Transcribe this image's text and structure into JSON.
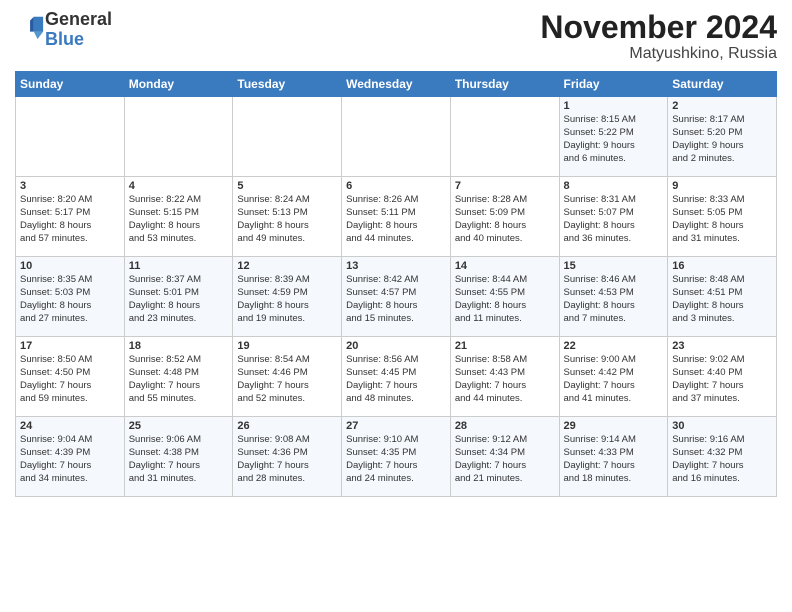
{
  "header": {
    "logo_general": "General",
    "logo_blue": "Blue",
    "month_title": "November 2024",
    "location": "Matyushkino, Russia"
  },
  "days_of_week": [
    "Sunday",
    "Monday",
    "Tuesday",
    "Wednesday",
    "Thursday",
    "Friday",
    "Saturday"
  ],
  "weeks": [
    [
      {
        "day": "",
        "info": ""
      },
      {
        "day": "",
        "info": ""
      },
      {
        "day": "",
        "info": ""
      },
      {
        "day": "",
        "info": ""
      },
      {
        "day": "",
        "info": ""
      },
      {
        "day": "1",
        "info": "Sunrise: 8:15 AM\nSunset: 5:22 PM\nDaylight: 9 hours\nand 6 minutes."
      },
      {
        "day": "2",
        "info": "Sunrise: 8:17 AM\nSunset: 5:20 PM\nDaylight: 9 hours\nand 2 minutes."
      }
    ],
    [
      {
        "day": "3",
        "info": "Sunrise: 8:20 AM\nSunset: 5:17 PM\nDaylight: 8 hours\nand 57 minutes."
      },
      {
        "day": "4",
        "info": "Sunrise: 8:22 AM\nSunset: 5:15 PM\nDaylight: 8 hours\nand 53 minutes."
      },
      {
        "day": "5",
        "info": "Sunrise: 8:24 AM\nSunset: 5:13 PM\nDaylight: 8 hours\nand 49 minutes."
      },
      {
        "day": "6",
        "info": "Sunrise: 8:26 AM\nSunset: 5:11 PM\nDaylight: 8 hours\nand 44 minutes."
      },
      {
        "day": "7",
        "info": "Sunrise: 8:28 AM\nSunset: 5:09 PM\nDaylight: 8 hours\nand 40 minutes."
      },
      {
        "day": "8",
        "info": "Sunrise: 8:31 AM\nSunset: 5:07 PM\nDaylight: 8 hours\nand 36 minutes."
      },
      {
        "day": "9",
        "info": "Sunrise: 8:33 AM\nSunset: 5:05 PM\nDaylight: 8 hours\nand 31 minutes."
      }
    ],
    [
      {
        "day": "10",
        "info": "Sunrise: 8:35 AM\nSunset: 5:03 PM\nDaylight: 8 hours\nand 27 minutes."
      },
      {
        "day": "11",
        "info": "Sunrise: 8:37 AM\nSunset: 5:01 PM\nDaylight: 8 hours\nand 23 minutes."
      },
      {
        "day": "12",
        "info": "Sunrise: 8:39 AM\nSunset: 4:59 PM\nDaylight: 8 hours\nand 19 minutes."
      },
      {
        "day": "13",
        "info": "Sunrise: 8:42 AM\nSunset: 4:57 PM\nDaylight: 8 hours\nand 15 minutes."
      },
      {
        "day": "14",
        "info": "Sunrise: 8:44 AM\nSunset: 4:55 PM\nDaylight: 8 hours\nand 11 minutes."
      },
      {
        "day": "15",
        "info": "Sunrise: 8:46 AM\nSunset: 4:53 PM\nDaylight: 8 hours\nand 7 minutes."
      },
      {
        "day": "16",
        "info": "Sunrise: 8:48 AM\nSunset: 4:51 PM\nDaylight: 8 hours\nand 3 minutes."
      }
    ],
    [
      {
        "day": "17",
        "info": "Sunrise: 8:50 AM\nSunset: 4:50 PM\nDaylight: 7 hours\nand 59 minutes."
      },
      {
        "day": "18",
        "info": "Sunrise: 8:52 AM\nSunset: 4:48 PM\nDaylight: 7 hours\nand 55 minutes."
      },
      {
        "day": "19",
        "info": "Sunrise: 8:54 AM\nSunset: 4:46 PM\nDaylight: 7 hours\nand 52 minutes."
      },
      {
        "day": "20",
        "info": "Sunrise: 8:56 AM\nSunset: 4:45 PM\nDaylight: 7 hours\nand 48 minutes."
      },
      {
        "day": "21",
        "info": "Sunrise: 8:58 AM\nSunset: 4:43 PM\nDaylight: 7 hours\nand 44 minutes."
      },
      {
        "day": "22",
        "info": "Sunrise: 9:00 AM\nSunset: 4:42 PM\nDaylight: 7 hours\nand 41 minutes."
      },
      {
        "day": "23",
        "info": "Sunrise: 9:02 AM\nSunset: 4:40 PM\nDaylight: 7 hours\nand 37 minutes."
      }
    ],
    [
      {
        "day": "24",
        "info": "Sunrise: 9:04 AM\nSunset: 4:39 PM\nDaylight: 7 hours\nand 34 minutes."
      },
      {
        "day": "25",
        "info": "Sunrise: 9:06 AM\nSunset: 4:38 PM\nDaylight: 7 hours\nand 31 minutes."
      },
      {
        "day": "26",
        "info": "Sunrise: 9:08 AM\nSunset: 4:36 PM\nDaylight: 7 hours\nand 28 minutes."
      },
      {
        "day": "27",
        "info": "Sunrise: 9:10 AM\nSunset: 4:35 PM\nDaylight: 7 hours\nand 24 minutes."
      },
      {
        "day": "28",
        "info": "Sunrise: 9:12 AM\nSunset: 4:34 PM\nDaylight: 7 hours\nand 21 minutes."
      },
      {
        "day": "29",
        "info": "Sunrise: 9:14 AM\nSunset: 4:33 PM\nDaylight: 7 hours\nand 18 minutes."
      },
      {
        "day": "30",
        "info": "Sunrise: 9:16 AM\nSunset: 4:32 PM\nDaylight: 7 hours\nand 16 minutes."
      }
    ]
  ]
}
